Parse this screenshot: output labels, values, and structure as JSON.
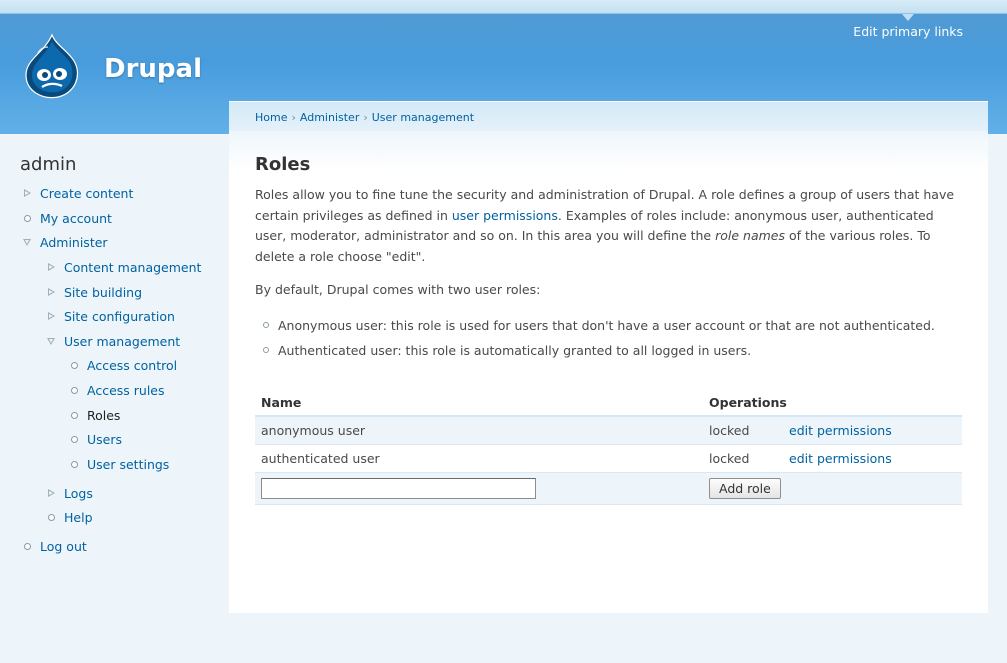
{
  "header": {
    "site_name": "Drupal",
    "primary_links_label": "Edit primary links"
  },
  "sidebar": {
    "user_name": "admin",
    "items": [
      {
        "label": "Create content",
        "state": "collapsed",
        "depth": 0
      },
      {
        "label": "My account",
        "state": "leaf",
        "depth": 0
      },
      {
        "label": "Administer",
        "state": "expanded",
        "depth": 0
      },
      {
        "label": "Content management",
        "state": "collapsed",
        "depth": 1
      },
      {
        "label": "Site building",
        "state": "collapsed",
        "depth": 1
      },
      {
        "label": "Site configuration",
        "state": "collapsed",
        "depth": 1
      },
      {
        "label": "User management",
        "state": "expanded",
        "depth": 1
      },
      {
        "label": "Access control",
        "state": "leaf",
        "depth": 2
      },
      {
        "label": "Access rules",
        "state": "leaf",
        "depth": 2
      },
      {
        "label": "Roles",
        "state": "leaf",
        "depth": 2,
        "active": true
      },
      {
        "label": "Users",
        "state": "leaf",
        "depth": 2
      },
      {
        "label": "User settings",
        "state": "leaf",
        "depth": 2
      },
      {
        "label": "Logs",
        "state": "collapsed",
        "depth": 1
      },
      {
        "label": "Help",
        "state": "leaf",
        "depth": 1
      },
      {
        "label": "Log out",
        "state": "leaf",
        "depth": 0
      }
    ]
  },
  "breadcrumb": {
    "items": [
      "Home",
      "Administer",
      "User management"
    ],
    "separator": "›"
  },
  "page": {
    "title": "Roles",
    "intro": {
      "part1": "Roles allow you to fine tune the security and administration of Drupal. A role defines a group of users that have certain privileges as defined in ",
      "link": "user permissions",
      "part2": ". Examples of roles include: anonymous user, authenticated user, moderator, administrator and so on. In this area you will define the ",
      "emphasis": "role names",
      "part3": " of the various roles. To delete a role choose \"edit\"."
    },
    "default_roles_text": "By default, Drupal comes with two user roles:",
    "default_roles": [
      "Anonymous user: this role is used for users that don't have a user account or that are not authenticated.",
      "Authenticated user: this role is automatically granted to all logged in users."
    ]
  },
  "roles_table": {
    "headers": {
      "name": "Name",
      "operations": "Operations"
    },
    "rows": [
      {
        "name": "anonymous user",
        "status": "locked",
        "operation": "edit permissions"
      },
      {
        "name": "authenticated user",
        "status": "locked",
        "operation": "edit permissions"
      }
    ],
    "new_role_input_value": "",
    "add_button_label": "Add role"
  },
  "colors": {
    "header_blue": "#4a9ede",
    "link": "#0062a0",
    "page_background": "#edf5fa"
  }
}
